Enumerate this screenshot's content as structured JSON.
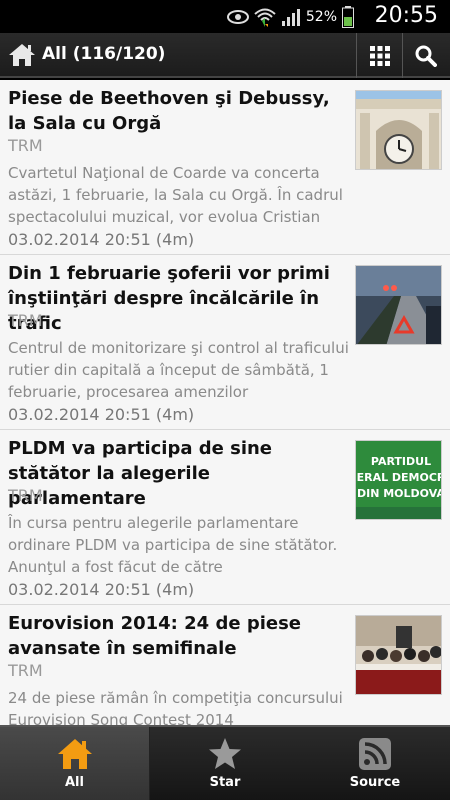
{
  "status_bar": {
    "battery_percent": "52%",
    "time": "20:55",
    "icons": [
      "eye-icon",
      "wifi-icon",
      "signal-icon",
      "battery-icon"
    ]
  },
  "action_bar": {
    "title": "All (116/120)",
    "icons": [
      "home-icon",
      "grid-icon",
      "search-icon"
    ]
  },
  "articles": [
    {
      "title": "Piese de Beethoven şi Debussy, la Sala cu Orgă",
      "source": "TRM",
      "description": "Cvartetul Naţional de Coarde va concerta astăzi, 1 februarie, la Sala cu Orgă. În cadrul spectacolului muzical, vor evolua Cristian",
      "date": "03.02.2014 20:51 (4m)"
    },
    {
      "title": "Din 1 februarie şoferii vor primi înştiinţări despre încălcările în trafic",
      "source": "TRM",
      "description": "Centrul de monitorizare şi control al traficului rutier din capitală a început de sâmbătă, 1 februarie, procesarea amenzilor",
      "date": "03.02.2014 20:51 (4m)"
    },
    {
      "title": "PLDM va participa de sine stătător la alegerile parlamentare",
      "source": "TRM",
      "description": "În cursa pentru alegerile parlamentare ordinare PLDM va participa de sine stătător. Anunţul a fost făcut de către",
      "date": "03.02.2014 20:51 (4m)",
      "thumb_text": [
        "PARTIDUL",
        "ERAL DEMOCR",
        "DIN MOLDOVA"
      ]
    },
    {
      "title": "Eurovision 2014: 24 de piese avansate în semifinale",
      "source": "TRM",
      "description": "24 de piese rămân în competiţia concursului Eurovision Song Contest 2014",
      "date": ""
    }
  ],
  "bottom_nav": {
    "tabs": [
      {
        "label": "All",
        "icon": "home-icon",
        "active": true
      },
      {
        "label": "Star",
        "icon": "star-icon",
        "active": false
      },
      {
        "label": "Source",
        "icon": "rss-icon",
        "active": false
      }
    ],
    "active_color": "#f39c12"
  }
}
